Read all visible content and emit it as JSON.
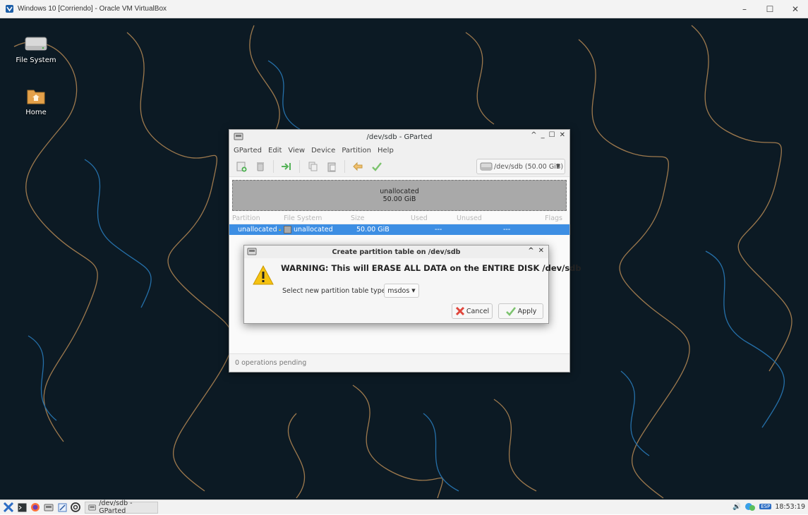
{
  "host": {
    "title": "Windows 10 [Corriendo] - Oracle VM VirtualBox",
    "controls": [
      "–",
      "☐",
      "✕"
    ]
  },
  "desktop": {
    "icons": [
      {
        "label": "File System",
        "icon": "drive-icon"
      },
      {
        "label": "Home",
        "icon": "home-folder-icon"
      }
    ]
  },
  "gparted": {
    "title": "/dev/sdb - GParted",
    "window_controls": [
      "^",
      "_",
      "☐",
      "✕"
    ],
    "menu": [
      "GParted",
      "Edit",
      "View",
      "Device",
      "Partition",
      "Help"
    ],
    "device_selector": "/dev/sdb (50.00 GiB)",
    "disk_bar": {
      "label": "unallocated",
      "size": "50.00 GiB"
    },
    "table": {
      "headers": [
        "Partition",
        "File System",
        "Size",
        "Used",
        "Unused",
        "Flags"
      ],
      "rows": [
        {
          "partition": "unallocated",
          "filesystem": "unallocated",
          "size": "50.00 GiB",
          "used": "---",
          "unused": "---",
          "flags": ""
        }
      ]
    },
    "status": "0 operations pending"
  },
  "dialog": {
    "title": "Create partition table on /dev/sdb",
    "window_controls": [
      "^",
      "✕"
    ],
    "warning": "WARNING:  This will ERASE ALL DATA on the ENTIRE DISK /dev/sdb",
    "select_label": "Select new partition table type:",
    "select_value": "msdos",
    "cancel_label": "Cancel",
    "apply_label": "Apply"
  },
  "taskbar": {
    "task_label": "/dev/sdb - GParted",
    "clock": "18:53:19"
  },
  "colors": {
    "selection": "#3d8ee3",
    "desktop_bg": "#0c1a24",
    "wallpaper_lines_orange": "#b78a55",
    "wallpaper_lines_blue": "#2a7fc1"
  }
}
